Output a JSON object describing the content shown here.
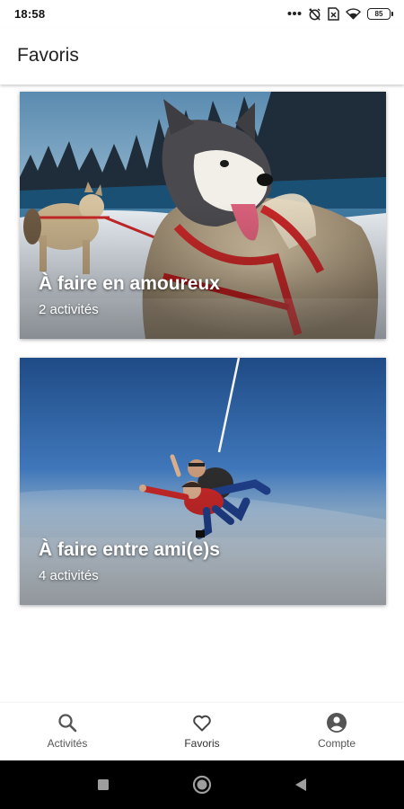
{
  "status_bar": {
    "time": "18:58",
    "battery": "85",
    "icons": [
      "more-dots-icon",
      "alarm-off-icon",
      "sim-card-icon",
      "wifi-icon",
      "battery-icon"
    ]
  },
  "app_bar": {
    "title": "Favoris"
  },
  "favorites": [
    {
      "title": "À faire en amoureux",
      "subtitle": "2 activités",
      "image": "husky-sled-dogs-photo"
    },
    {
      "title": "À faire entre ami(e)s",
      "subtitle": "4 activités",
      "image": "tandem-skydiving-photo"
    }
  ],
  "bottom_nav": {
    "items": [
      {
        "label": "Activités",
        "icon": "search-icon"
      },
      {
        "label": "Favoris",
        "icon": "heart-icon"
      },
      {
        "label": "Compte",
        "icon": "account-circle-icon"
      }
    ],
    "active": "Favoris"
  },
  "system_nav": {
    "icons": [
      "recents-square-icon",
      "home-circle-icon",
      "back-triangle-icon"
    ]
  },
  "colors": {
    "status_icon": "#222222",
    "nav_icon": "#555555",
    "system_bar": "#000000",
    "harness_red": "#c62828"
  }
}
